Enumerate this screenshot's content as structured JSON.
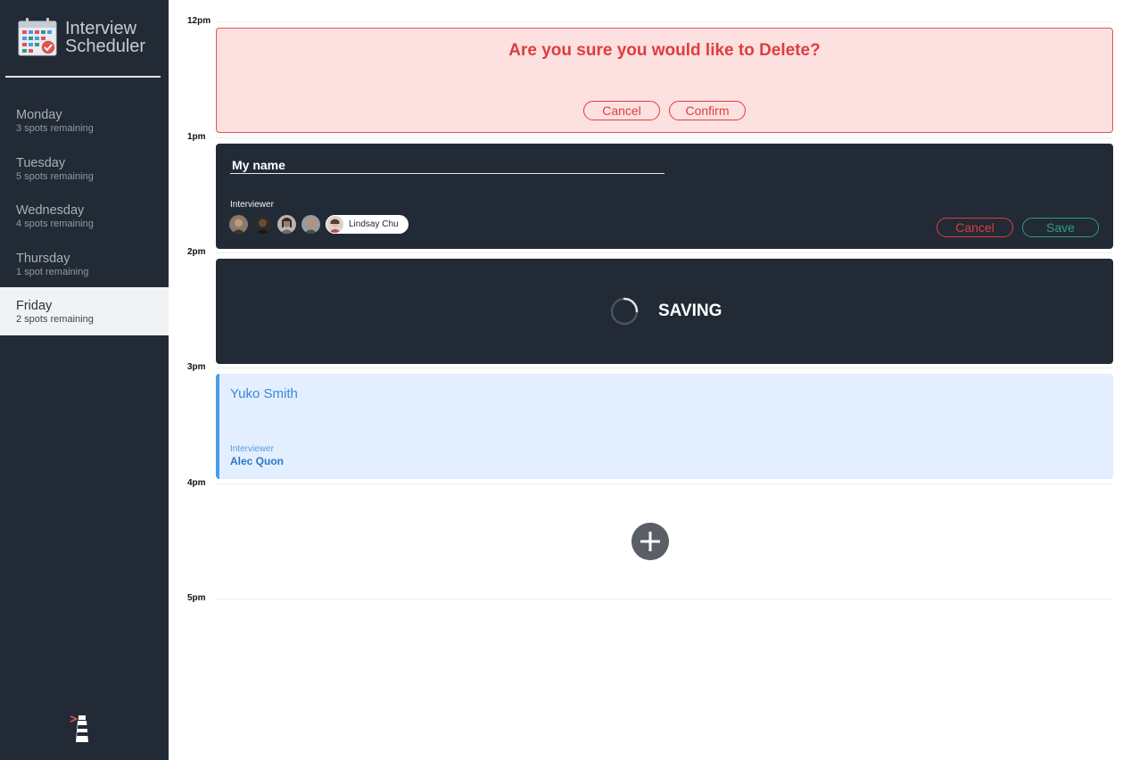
{
  "app": {
    "title_line1": "Interview",
    "title_line2": "Scheduler"
  },
  "sidebar": {
    "days": [
      {
        "name": "Monday",
        "spots": "3 spots remaining"
      },
      {
        "name": "Tuesday",
        "spots": "5 spots remaining"
      },
      {
        "name": "Wednesday",
        "spots": "4 spots remaining"
      },
      {
        "name": "Thursday",
        "spots": "1 spot remaining"
      },
      {
        "name": "Friday",
        "spots": "2 spots remaining",
        "selected": true
      }
    ]
  },
  "schedule": {
    "hours": [
      "12pm",
      "1pm",
      "2pm",
      "3pm",
      "4pm",
      "5pm"
    ],
    "confirm": {
      "message": "Are you sure you would like to Delete?",
      "cancel_label": "Cancel",
      "confirm_label": "Confirm"
    },
    "form": {
      "name_value": "My name",
      "interviewer_label": "Interviewer",
      "selected_interviewer": "Lindsay Chu",
      "cancel_label": "Cancel",
      "save_label": "Save"
    },
    "status": {
      "message": "SAVING"
    },
    "show": {
      "student": "Yuko Smith",
      "interviewer_label": "Interviewer",
      "interviewer": "Alec Quon"
    }
  },
  "colors": {
    "sidebar_bg": "#222a35",
    "danger": "#de3e3e",
    "success": "#2f9b80",
    "info": "#4a9be9",
    "add_button": "#5a5f66"
  },
  "icons": {
    "logo": "calendar-icon",
    "add": "plus-icon",
    "spinner": "spinner-icon",
    "footer": "lighthouse-icon"
  }
}
